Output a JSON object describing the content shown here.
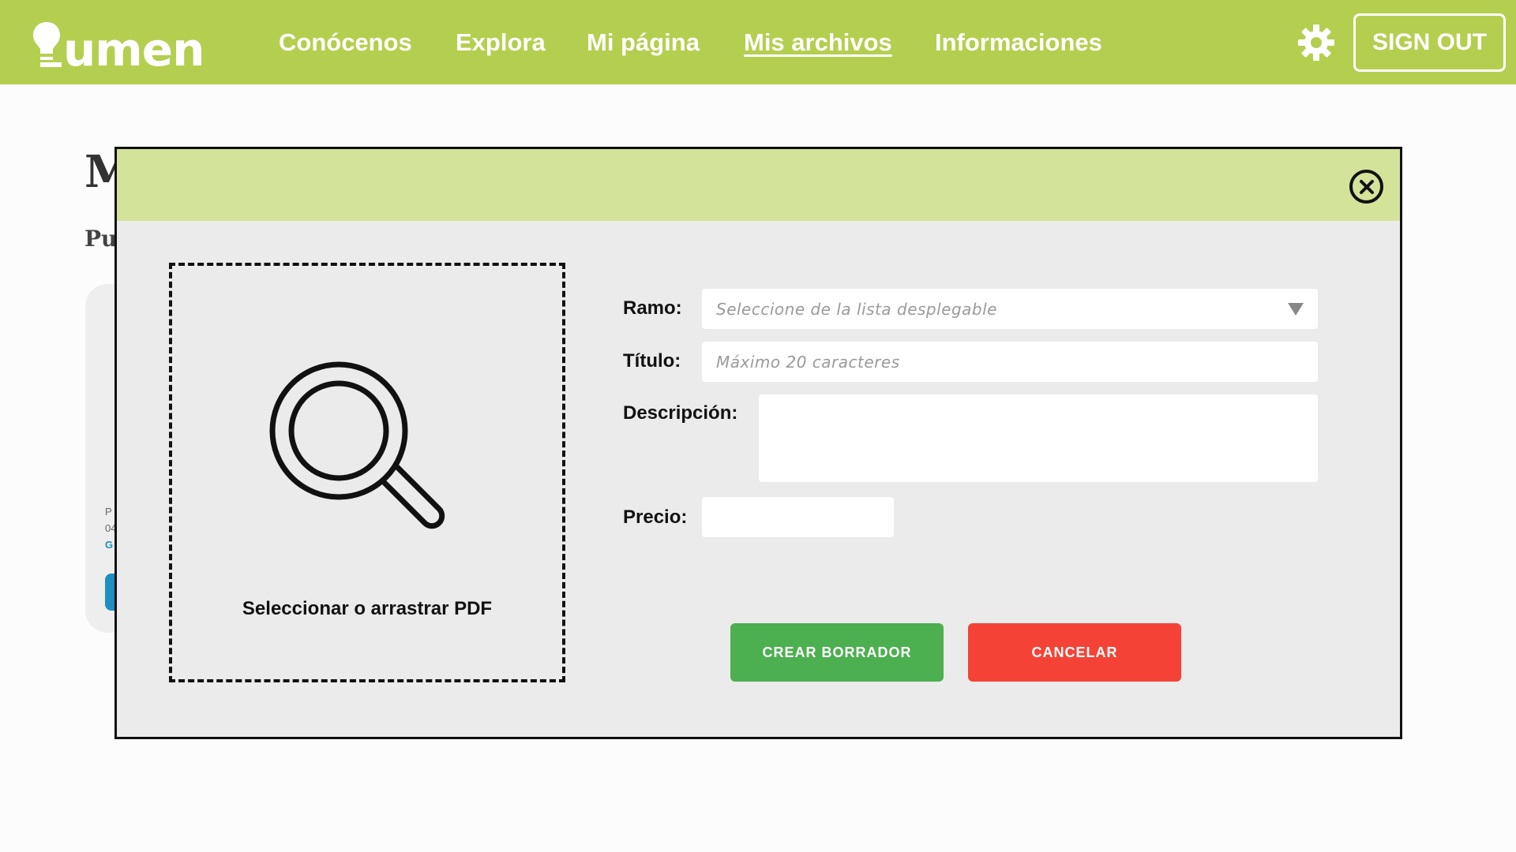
{
  "app": {
    "logo_text": "umen",
    "logo_alt": "lumen"
  },
  "nav": {
    "items": [
      {
        "label": "Conócenos",
        "active": false
      },
      {
        "label": "Explora",
        "active": false
      },
      {
        "label": "Mi página",
        "active": false
      },
      {
        "label": "Mis archivos",
        "active": true
      },
      {
        "label": "Informaciones",
        "active": false
      }
    ],
    "settings_icon": "gear-icon",
    "signout_label": "SIGN OUT"
  },
  "background_page": {
    "title_fragment": "M",
    "subtitle_fragment": "Pu",
    "card_text": [
      "P",
      "04",
      "G"
    ]
  },
  "modal": {
    "close_icon": "close-icon",
    "dropzone": {
      "icon": "search-icon",
      "label": "Seleccionar o arrastrar PDF"
    },
    "fields": {
      "ramo": {
        "label": "Ramo:",
        "placeholder": "Seleccione de la lista desplegable",
        "value": ""
      },
      "titulo": {
        "label": "Título:",
        "placeholder": "Máximo 20 caracteres",
        "value": ""
      },
      "descripcion": {
        "label": "Descripción:",
        "value": ""
      },
      "precio": {
        "label": "Precio:",
        "value": ""
      }
    },
    "buttons": {
      "create_draft": "CREAR BORRADOR",
      "cancel": "CANCELAR"
    }
  },
  "colors": {
    "nav_bg": "#b4cf50",
    "modal_header_bg": "#d3e39a",
    "modal_bg": "#ebebeb",
    "create_button": "#4caf50",
    "cancel_button": "#f44336",
    "link_blue": "#1e8fc0"
  }
}
